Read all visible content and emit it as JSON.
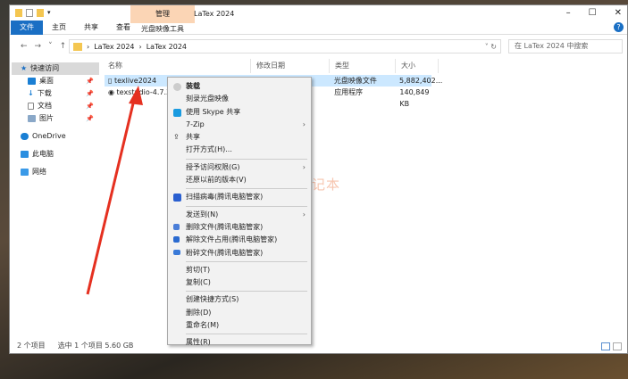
{
  "window": {
    "title": "LaTex 2024",
    "context_tab": "管理",
    "context_tab_sub": "光盘映像工具",
    "controls": [
      "–",
      "☐",
      "✕"
    ],
    "help": "?"
  },
  "ribbon": {
    "tabs": [
      "文件",
      "主页",
      "共享",
      "查看"
    ]
  },
  "address": {
    "path": [
      "LaTex 2024",
      "LaTex 2024"
    ],
    "search_placeholder": "在 LaTex 2024 中搜索"
  },
  "sidebar": {
    "items": [
      {
        "label": "快速访问",
        "icon": "star-icon"
      },
      {
        "label": "桌面",
        "icon": "desktop-icon"
      },
      {
        "label": "下载",
        "icon": "download-icon"
      },
      {
        "label": "文档",
        "icon": "document-icon"
      },
      {
        "label": "图片",
        "icon": "pictures-icon"
      },
      {
        "label": "OneDrive",
        "icon": "cloud-icon"
      },
      {
        "label": "此电脑",
        "icon": "computer-icon"
      },
      {
        "label": "网络",
        "icon": "network-icon"
      }
    ]
  },
  "columns": [
    "名称",
    "修改日期",
    "类型",
    "大小"
  ],
  "files": [
    {
      "name": "texlive2024",
      "type": "光盘映像文件",
      "size": "5,882,402..."
    },
    {
      "name": "texstudio-4.7.3-",
      "type": "应用程序",
      "size": "140,849 KB"
    }
  ],
  "status": {
    "count": "2 个项目",
    "selected": "选中 1 个项目  5.60 GB"
  },
  "menu": {
    "items": [
      "装载",
      "刻录光盘映像",
      "使用 Skype 共享",
      "7-Zip",
      "共享",
      "打开方式(H)...",
      "授予访问权限(G)",
      "还原以前的版本(V)",
      "扫描病毒(腾讯电脑管家)",
      "发送到(N)",
      "删除文件(腾讯电脑管家)",
      "解除文件占用(腾讯电脑管家)",
      "粉碎文件(腾讯电脑管家)",
      "剪切(T)",
      "复制(C)",
      "创建快捷方式(S)",
      "删除(D)",
      "重命名(M)",
      "属性(R)"
    ]
  },
  "watermark": "丁同学日记本",
  "colors": {
    "accent": "#1a6fc4",
    "selection": "#cce8ff",
    "arrow": "#e53020"
  }
}
